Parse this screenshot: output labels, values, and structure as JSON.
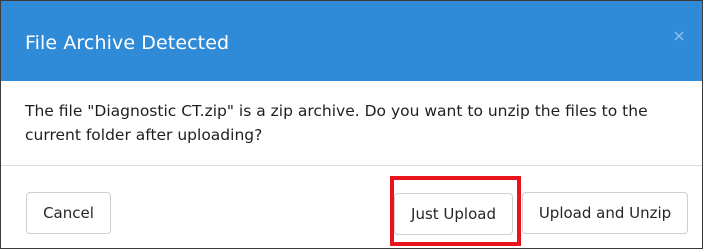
{
  "dialog": {
    "title": "File Archive Detected",
    "close_icon": "close-icon",
    "message": "The file \"Diagnostic CT.zip\" is a zip archive. Do you want to unzip the files to the current folder after uploading?",
    "buttons": {
      "cancel": "Cancel",
      "just_upload": "Just Upload",
      "upload_and_unzip": "Upload and Unzip"
    }
  },
  "colors": {
    "header_background": "#2f8ad8",
    "highlight_border": "#e8131b"
  }
}
